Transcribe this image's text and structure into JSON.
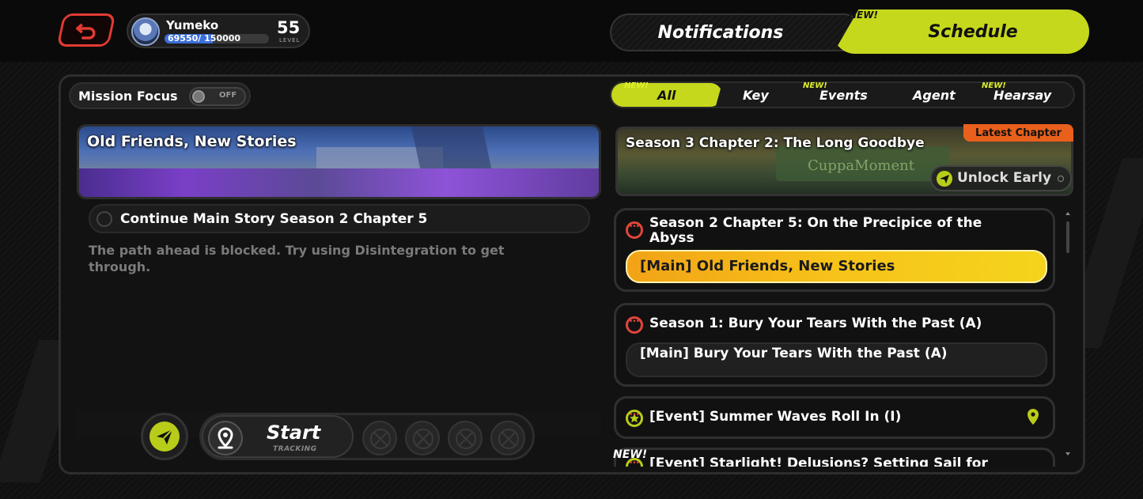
{
  "player": {
    "name": "Yumeko",
    "xp_current": "69550",
    "xp_max": "150000",
    "xp_fraction": 0.4637,
    "level": "55",
    "level_label": "LEVEL"
  },
  "top_tabs": {
    "notifications": "Notifications",
    "schedule": "Schedule",
    "schedule_new": "NEW!",
    "active": "Schedule"
  },
  "mission_focus": {
    "label": "Mission Focus",
    "toggle": "OFF"
  },
  "quest": {
    "banner_title": "Old Friends, New Stories",
    "objective": "Continue Main Story Season 2 Chapter 5",
    "description": "The path ahead is blocked. Try using Disintegration to get through."
  },
  "tracking": {
    "start_label": "Start",
    "sub_label": "TRACKING",
    "empty_slots": 4
  },
  "filters": [
    {
      "label": "All",
      "new": "NEW!",
      "active": true
    },
    {
      "label": "Key",
      "new": "",
      "active": false
    },
    {
      "label": "Events",
      "new": "NEW!",
      "active": false
    },
    {
      "label": "Agent",
      "new": "",
      "active": false
    },
    {
      "label": "Hearsay",
      "new": "NEW!",
      "active": false
    }
  ],
  "latest_chapter": {
    "tag": "Latest Chapter",
    "title": "Season 3 Chapter 2: The Long Goodbye",
    "sign_text": "CuppaMoment",
    "unlock_label": "Unlock Early"
  },
  "cards": [
    {
      "title": "Season 2 Chapter 5: On the Precipice of the Abyss",
      "sub": "[Main] Old Friends, New Stories",
      "icon": "dots-icon"
    },
    {
      "title": "Season 1: Bury Your Tears With the Past (A)",
      "sub": "[Main] Bury Your Tears With the Past (A)",
      "icon": "dots-icon"
    },
    {
      "title": "[Event] Summer Waves Roll In (I)",
      "icon": "star-icon"
    },
    {
      "title": "[Event] Starlight! Delusions? Setting Sail for",
      "new": "NEW!",
      "icon": "star-icon"
    }
  ],
  "colors": {
    "accent": "#c6d81c",
    "alert": "#e2453b",
    "highlight": "#f7c31a",
    "latest_tag": "#e8601c"
  }
}
